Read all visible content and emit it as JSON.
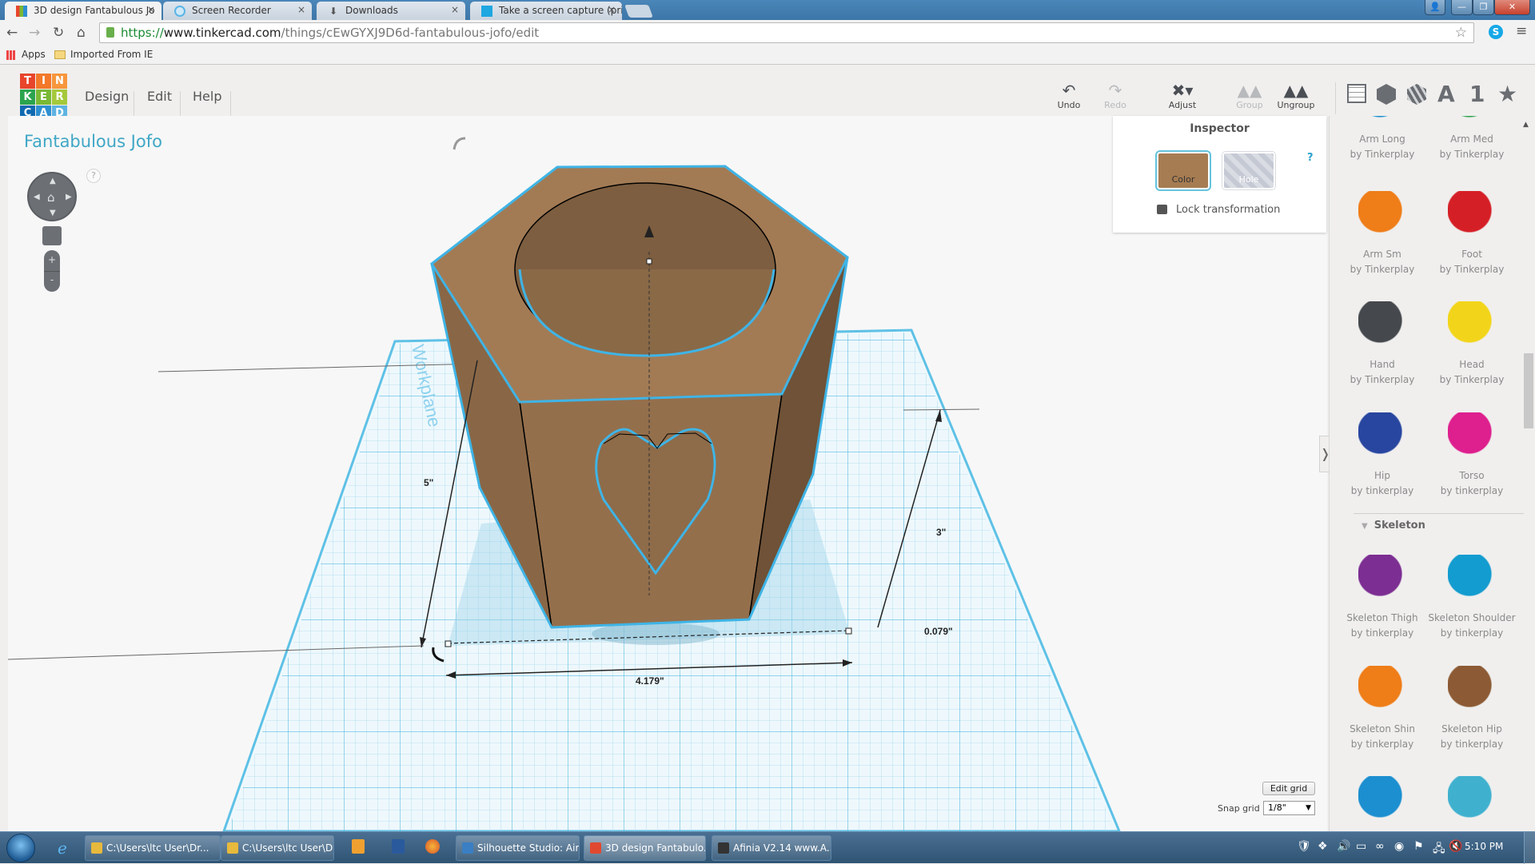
{
  "browser": {
    "tabs": [
      {
        "title": "3D design Fantabulous Jo",
        "icon": "tinkercad-icon",
        "active": true
      },
      {
        "title": "Screen Recorder",
        "icon": "screen-recorder-icon",
        "active": false
      },
      {
        "title": "Downloads",
        "icon": "download-icon",
        "active": false
      },
      {
        "title": "Take a screen capture (pri",
        "icon": "windows-icon",
        "active": false
      }
    ],
    "close_glyph": "×",
    "url_scheme": "https://",
    "url_host": "www.tinkercad.com",
    "url_path": "/things/cEwGYXJ9D6d-fantabulous-jofo/edit",
    "bookmarks": [
      {
        "label": "Apps",
        "icon": "apps-grid-icon"
      },
      {
        "label": "Imported From IE",
        "icon": "folder-icon"
      }
    ],
    "window_buttons": {
      "user": "👤",
      "minimize": "—",
      "maximize": "❐",
      "close": "✕"
    }
  },
  "app": {
    "logo_letters": [
      "T",
      "I",
      "N",
      "K",
      "E",
      "R",
      "C",
      "A",
      "D"
    ],
    "logo_colors": [
      "#e8452c",
      "#f3782a",
      "#f7963d",
      "#2ca44e",
      "#7ab935",
      "#a5c93b",
      "#1069b0",
      "#2e8fd0",
      "#5db3e2"
    ],
    "menu": [
      "Design",
      "Edit",
      "Help"
    ],
    "toolbar": {
      "undo": "Undo",
      "redo": "Redo",
      "adjust": "Adjust",
      "group": "Group",
      "ungroup": "Ungroup"
    },
    "view_icons": [
      "grid-view-icon",
      "solid-box-icon",
      "hole-box-icon",
      "text-A-icon",
      "number-1-icon",
      "star-icon"
    ],
    "view_glyphs": {
      "text": "A",
      "number": "1",
      "star": "★"
    },
    "design_title": "Fantabulous Jofo",
    "help": "?"
  },
  "inspector": {
    "title": "Inspector",
    "color_label": "Color",
    "hole_label": "Hole",
    "color_value": "#a67c52",
    "help": "?",
    "lock_label": "Lock transformation"
  },
  "dimensions": {
    "height": "5\"",
    "depth": "3\"",
    "width": "4.179\"",
    "elevation": "0.079\"",
    "workplane_label": "Workplane"
  },
  "library": {
    "items": [
      {
        "name": "Arm Long",
        "by": "by Tinkerplay",
        "color": "#1f8fd0"
      },
      {
        "name": "Arm Med",
        "by": "by Tinkerplay",
        "color": "#2ea44f"
      },
      {
        "name": "Arm Sm",
        "by": "by Tinkerplay",
        "color": "#ef7d18"
      },
      {
        "name": "Foot",
        "by": "by Tinkerplay",
        "color": "#d51f26"
      },
      {
        "name": "Hand",
        "by": "by Tinkerplay",
        "color": "#45484c"
      },
      {
        "name": "Head",
        "by": "by Tinkerplay",
        "color": "#f2d51a"
      },
      {
        "name": "Hip",
        "by": "by tinkerplay",
        "color": "#2846a0"
      },
      {
        "name": "Torso",
        "by": "by tinkerplay",
        "color": "#de1f8e"
      }
    ],
    "section": "Skeleton",
    "skeleton_items": [
      {
        "name": "Skeleton Thigh",
        "by": "by tinkerplay",
        "color": "#7c2e92"
      },
      {
        "name": "Skeleton Shoulder",
        "by": "by tinkerplay",
        "color": "#139ccf"
      },
      {
        "name": "Skeleton Shin",
        "by": "by tinkerplay",
        "color": "#ef7d18"
      },
      {
        "name": "Skeleton Hip",
        "by": "by tinkerplay",
        "color": "#8c5a34"
      },
      {
        "name": "",
        "by": "",
        "color": "#1c8fd0"
      },
      {
        "name": "",
        "by": "",
        "color": "#3fb1cf"
      }
    ],
    "toggle_glyph": "❭"
  },
  "grid": {
    "edit_grid": "Edit grid",
    "snap_label": "Snap grid",
    "snap_value": "1/8\""
  },
  "taskbar": {
    "items": [
      {
        "label": "C:\\Users\\ltc User\\Dr...",
        "color": "#e7b93c"
      },
      {
        "label": "C:\\Users\\ltc User\\Dr...",
        "color": "#e7b93c"
      },
      {
        "label": "Silhouette Studio: Air...",
        "color": "#3a7fc4"
      },
      {
        "label": "3D design Fantabulo...",
        "color": "#e0492f",
        "active": true
      },
      {
        "label": "Afinia  V2.14  www.A...",
        "color": "#333333"
      }
    ],
    "clock": "5:10 PM"
  }
}
